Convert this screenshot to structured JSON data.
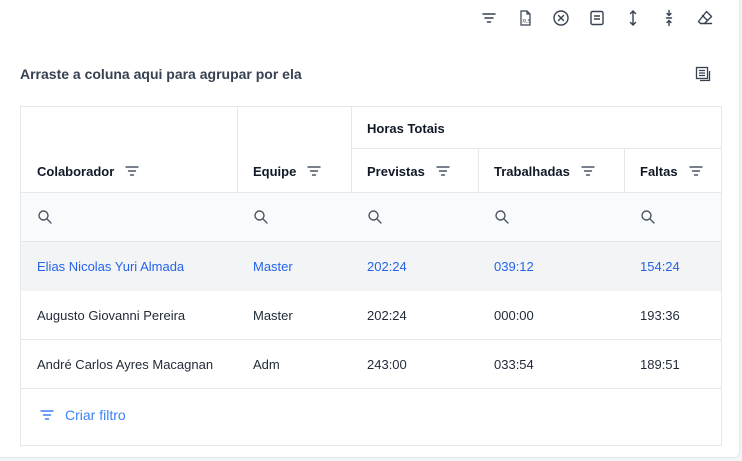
{
  "toolbar": {
    "icons": [
      "filter-icon",
      "export-xls-icon",
      "clear-icon",
      "layout-icon",
      "expand-rows-icon",
      "collapse-rows-icon",
      "eraser-icon"
    ]
  },
  "group_panel": {
    "hint": "Arraste a coluna aqui para agrupar por ela"
  },
  "grid": {
    "band_header": "Horas Totais",
    "columns": [
      "Colaborador",
      "Equipe",
      "Previstas",
      "Trabalhadas",
      "Faltas"
    ],
    "rows": [
      [
        "Elias Nicolas Yuri Almada",
        "Master",
        "202:24",
        "039:12",
        "154:24"
      ],
      [
        "Augusto Giovanni Pereira",
        "Master",
        "202:24",
        "000:00",
        "193:36"
      ],
      [
        "André Carlos Ayres Macagnan",
        "Adm",
        "243:00",
        "033:54",
        "189:51"
      ]
    ],
    "selected_row": 0
  },
  "footer": {
    "create_filter": "Criar filtro"
  },
  "colors": {
    "accent": "#2563eb",
    "selected_row_bg": "#f3f4f6",
    "filter_row_bg": "#f8fafc"
  }
}
